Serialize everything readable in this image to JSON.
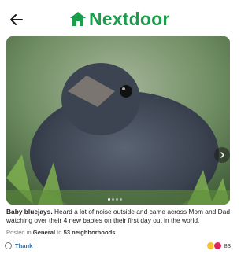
{
  "header": {
    "back_icon": "arrow-left-icon",
    "brand_icon": "house-icon",
    "brand_name": "Nextdoor",
    "brand_color": "#1a9e4b"
  },
  "post": {
    "image": {
      "description_icon": "bird-photo",
      "carousel_total": 4,
      "carousel_current": 1
    },
    "caption_title": "Baby bluejays.",
    "caption_body": " Heard a lot of noise outside and came across Mom and Dad watching over their 4 new babies on their first day out in the world.",
    "posted_prefix": "Posted in ",
    "posted_category": "General",
    "posted_middle": " to ",
    "posted_audience": "53 neighborhoods"
  },
  "footer": {
    "thank_label": "Thank",
    "reaction_count": "83"
  }
}
